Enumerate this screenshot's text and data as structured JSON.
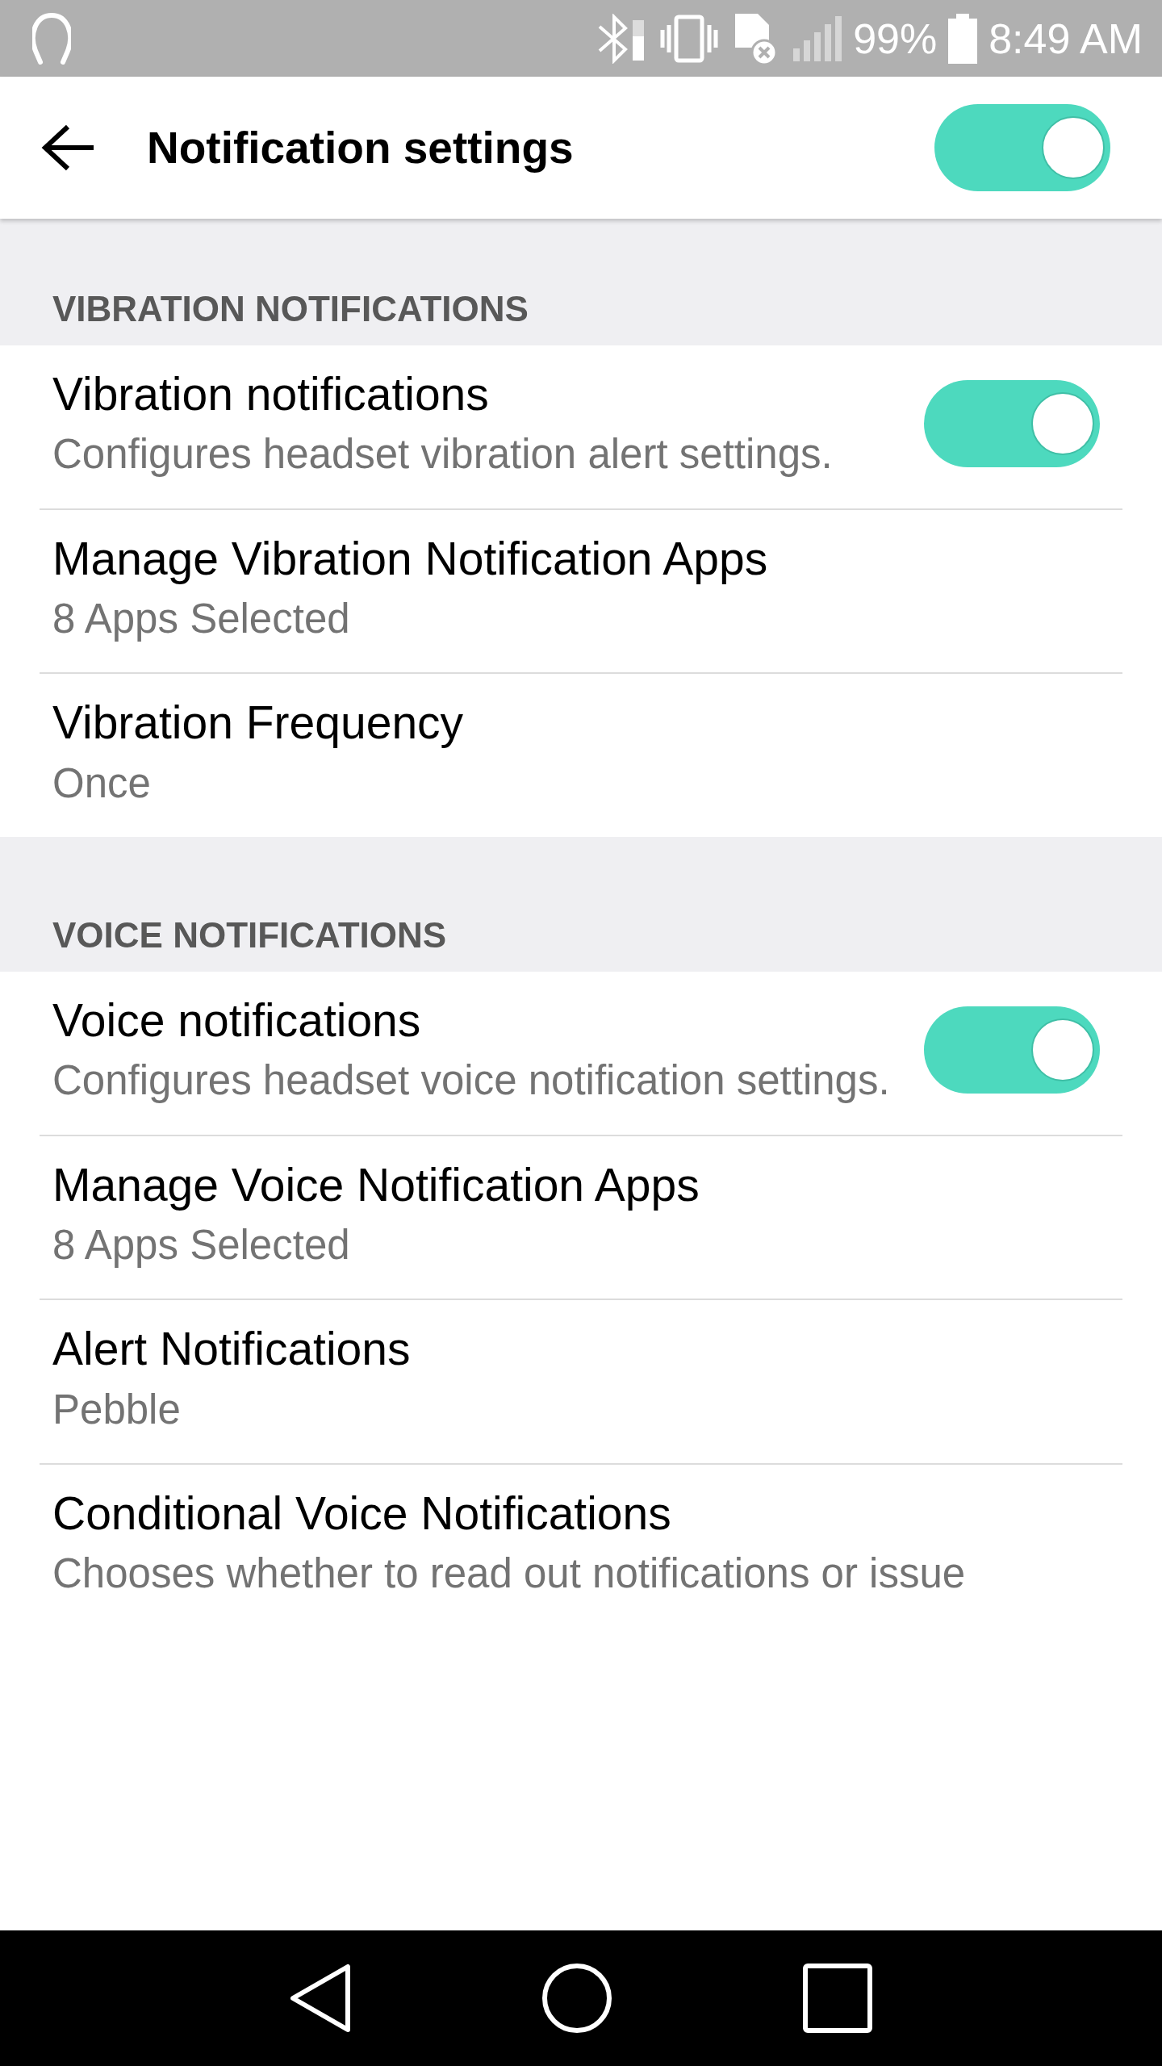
{
  "status_bar": {
    "battery": "99%",
    "time": "8:49 AM"
  },
  "app_bar": {
    "title": "Notification settings",
    "switch_on": true
  },
  "sections": [
    {
      "header": "VIBRATION NOTIFICATIONS",
      "items": [
        {
          "kind": "toggle",
          "title": "Vibration notifications",
          "subtitle": "Configures headset vibration alert settings.",
          "on": true
        },
        {
          "kind": "link",
          "title": "Manage Vibration Notification Apps",
          "subtitle": "8 Apps Selected"
        },
        {
          "kind": "link",
          "title": "Vibration Frequency",
          "subtitle": "Once"
        }
      ]
    },
    {
      "header": "VOICE NOTIFICATIONS",
      "items": [
        {
          "kind": "toggle",
          "title": "Voice notifications",
          "subtitle": "Configures headset voice notification settings.",
          "on": true
        },
        {
          "kind": "link",
          "title": "Manage Voice Notification Apps",
          "subtitle": "8 Apps Selected"
        },
        {
          "kind": "link",
          "title": "Alert Notifications",
          "subtitle": "Pebble"
        },
        {
          "kind": "link",
          "title": "Conditional Voice Notifications",
          "subtitle": "Chooses whether to read out notifications or issue"
        }
      ]
    }
  ]
}
